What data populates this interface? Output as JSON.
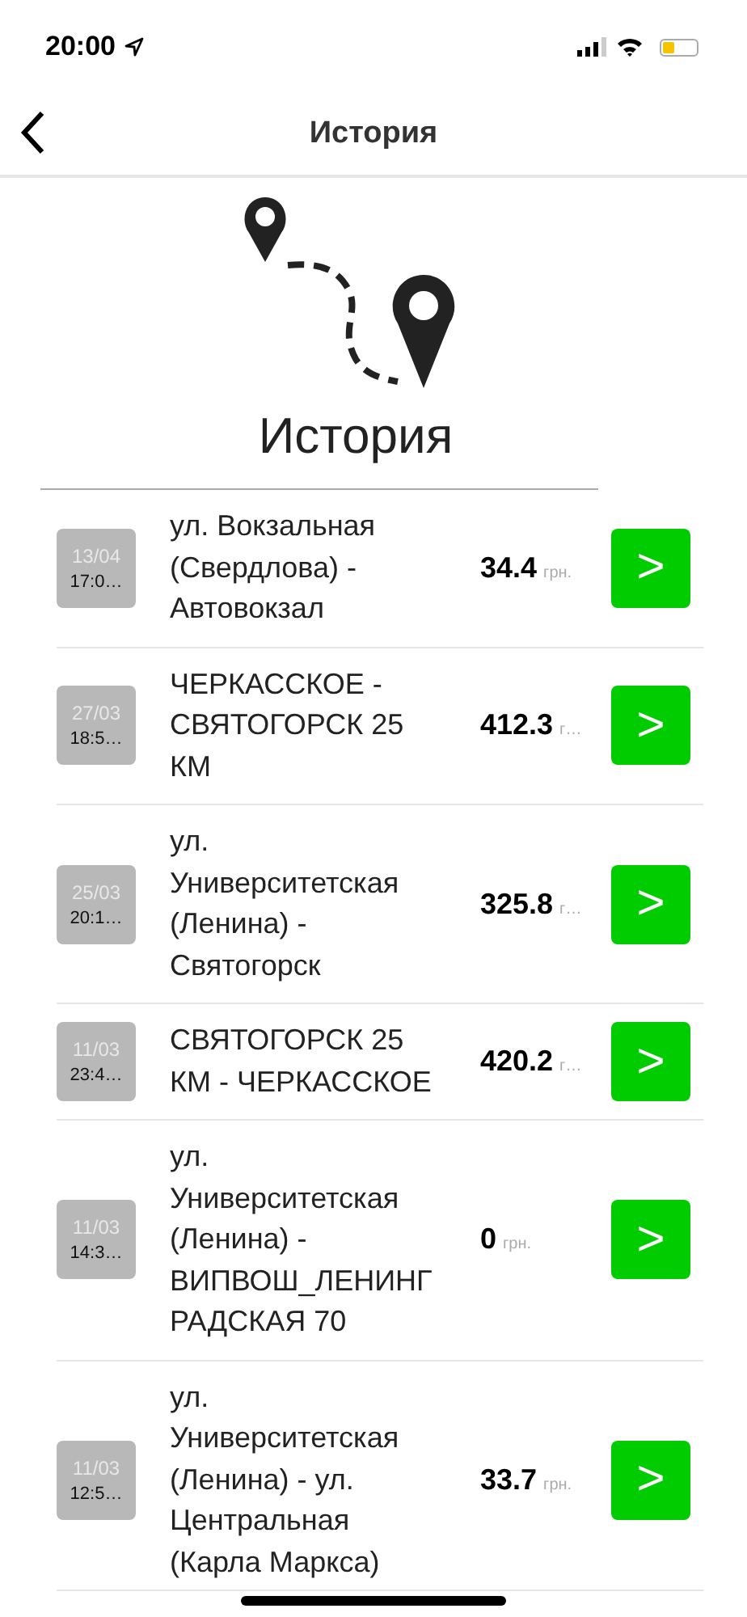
{
  "status_bar": {
    "time": "20:00"
  },
  "nav": {
    "title": "История"
  },
  "header": {
    "title": "История"
  },
  "trips": [
    {
      "date": "13/04",
      "time": "17:0…",
      "route": [
        "ул. Вокзальная",
        "(Свердлова) -",
        "Автовокзал"
      ],
      "price": "34.4",
      "currency": "грн.",
      "action": ">"
    },
    {
      "date": "27/03",
      "time": "18:5…",
      "route": [
        "ЧЕРКАССКОЕ -",
        "СВЯТОГОРСК 25",
        "КМ"
      ],
      "price": "412.3",
      "currency": "г…",
      "action": ">"
    },
    {
      "date": "25/03",
      "time": "20:1…",
      "route": [
        "ул.",
        "Университетская",
        "(Ленина) -",
        "Святогорск"
      ],
      "price": "325.8",
      "currency": "г…",
      "action": ">"
    },
    {
      "date": "11/03",
      "time": "23:4…",
      "route": [
        "СВЯТОГОРСК 25",
        "КМ - ЧЕРКАССКОЕ"
      ],
      "price": "420.2",
      "currency": "г…",
      "action": ">"
    },
    {
      "date": "11/03",
      "time": "14:3…",
      "route": [
        "ул.",
        "Университетская",
        "(Ленина) -",
        "ВИПВОШ_ЛЕНИНГ",
        "РАДСКАЯ 70"
      ],
      "price": "0",
      "currency": "грн.",
      "action": ">"
    },
    {
      "date": "11/03",
      "time": "12:5…",
      "route": [
        "ул.",
        "Университетская",
        "(Ленина) - ул.",
        "Центральная",
        "(Карла Маркса)"
      ],
      "price": "33.7",
      "currency": "грн.",
      "action": ">"
    }
  ]
}
